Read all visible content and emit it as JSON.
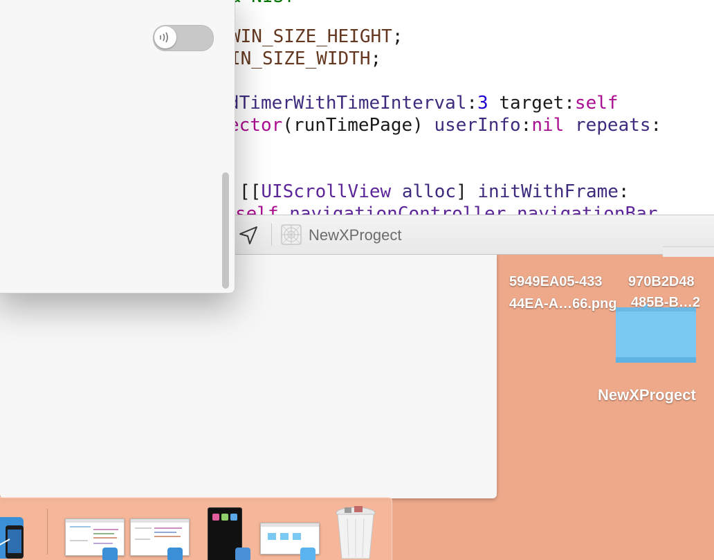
{
  "editor": {
    "lines": [
      {
        "segments": [
          {
            "t": "& NIST",
            "c": "green"
          }
        ]
      },
      {
        "segments": [
          {
            "t": "WIN_SIZE_HEIGHT",
            "c": "mac"
          },
          {
            "t": ";",
            "c": "plain"
          }
        ]
      },
      {
        "segments": [
          {
            "t": "IN_SIZE_WIDTH",
            "c": "mac"
          },
          {
            "t": ";",
            "c": "plain"
          }
        ]
      },
      {
        "segments": [
          {
            "t": "dTimerWithTimeInterval",
            "c": "meth"
          },
          {
            "t": ":",
            "c": "plain"
          },
          {
            "t": "3",
            "c": "num"
          },
          {
            "t": " target:",
            "c": "plain"
          },
          {
            "t": "self",
            "c": "kw"
          }
        ]
      },
      {
        "segments": [
          {
            "t": "ector",
            "c": "kw"
          },
          {
            "t": "(runTimePage) ",
            "c": "plain"
          },
          {
            "t": "userInfo",
            "c": "meth"
          },
          {
            "t": ":",
            "c": "plain"
          },
          {
            "t": "nil",
            "c": "kw"
          },
          {
            "t": " ",
            "c": "plain"
          },
          {
            "t": "repeats",
            "c": "meth"
          },
          {
            "t": ":",
            "c": "plain"
          }
        ]
      },
      {
        "segments": [
          {
            "t": "[[",
            "c": "plain"
          },
          {
            "t": "UIScrollView",
            "c": "cls"
          },
          {
            "t": " ",
            "c": "plain"
          },
          {
            "t": "alloc",
            "c": "meth"
          },
          {
            "t": "] ",
            "c": "plain"
          },
          {
            "t": "initWithFrame",
            "c": "meth"
          },
          {
            "t": ":",
            "c": "plain"
          }
        ]
      },
      {
        "segments": [
          {
            "t": "self",
            "c": "kw"
          },
          {
            "t": ".",
            "c": "plain"
          },
          {
            "t": "navigationController",
            "c": "cls"
          },
          {
            "t": ".",
            "c": "plain"
          },
          {
            "t": "navigationBar",
            "c": "cls"
          }
        ]
      }
    ],
    "jump_bar": {
      "project_name": "NewXProgect",
      "location_icon": "location-arrow-icon",
      "project_icon": "xcode-project-icon"
    }
  },
  "popover": {
    "toggle_icon": "radio-waves-icon",
    "toggle_state": "off"
  },
  "desktop": {
    "files": [
      {
        "line1": "5949EA05-433",
        "line2": "44EA-A…66.png"
      },
      {
        "line1": "970B2D48",
        "line2": "485B-B…2"
      }
    ],
    "folder_label": "NewXProgect",
    "folder_icon": "folder-icon"
  },
  "dock": {
    "items": [
      "xcode-app-icon",
      "window-thumbnail",
      "window-thumbnail",
      "simulator-thumbnail",
      "finder-window-thumbnail",
      "trash-full-icon"
    ]
  },
  "colors": {
    "desktop": "#eea98a",
    "keyword": "#aa0d91",
    "number": "#1c00cf",
    "macro": "#643820",
    "method": "#3f2a7e",
    "class": "#5c2699",
    "folder": "#7bc8f2"
  }
}
